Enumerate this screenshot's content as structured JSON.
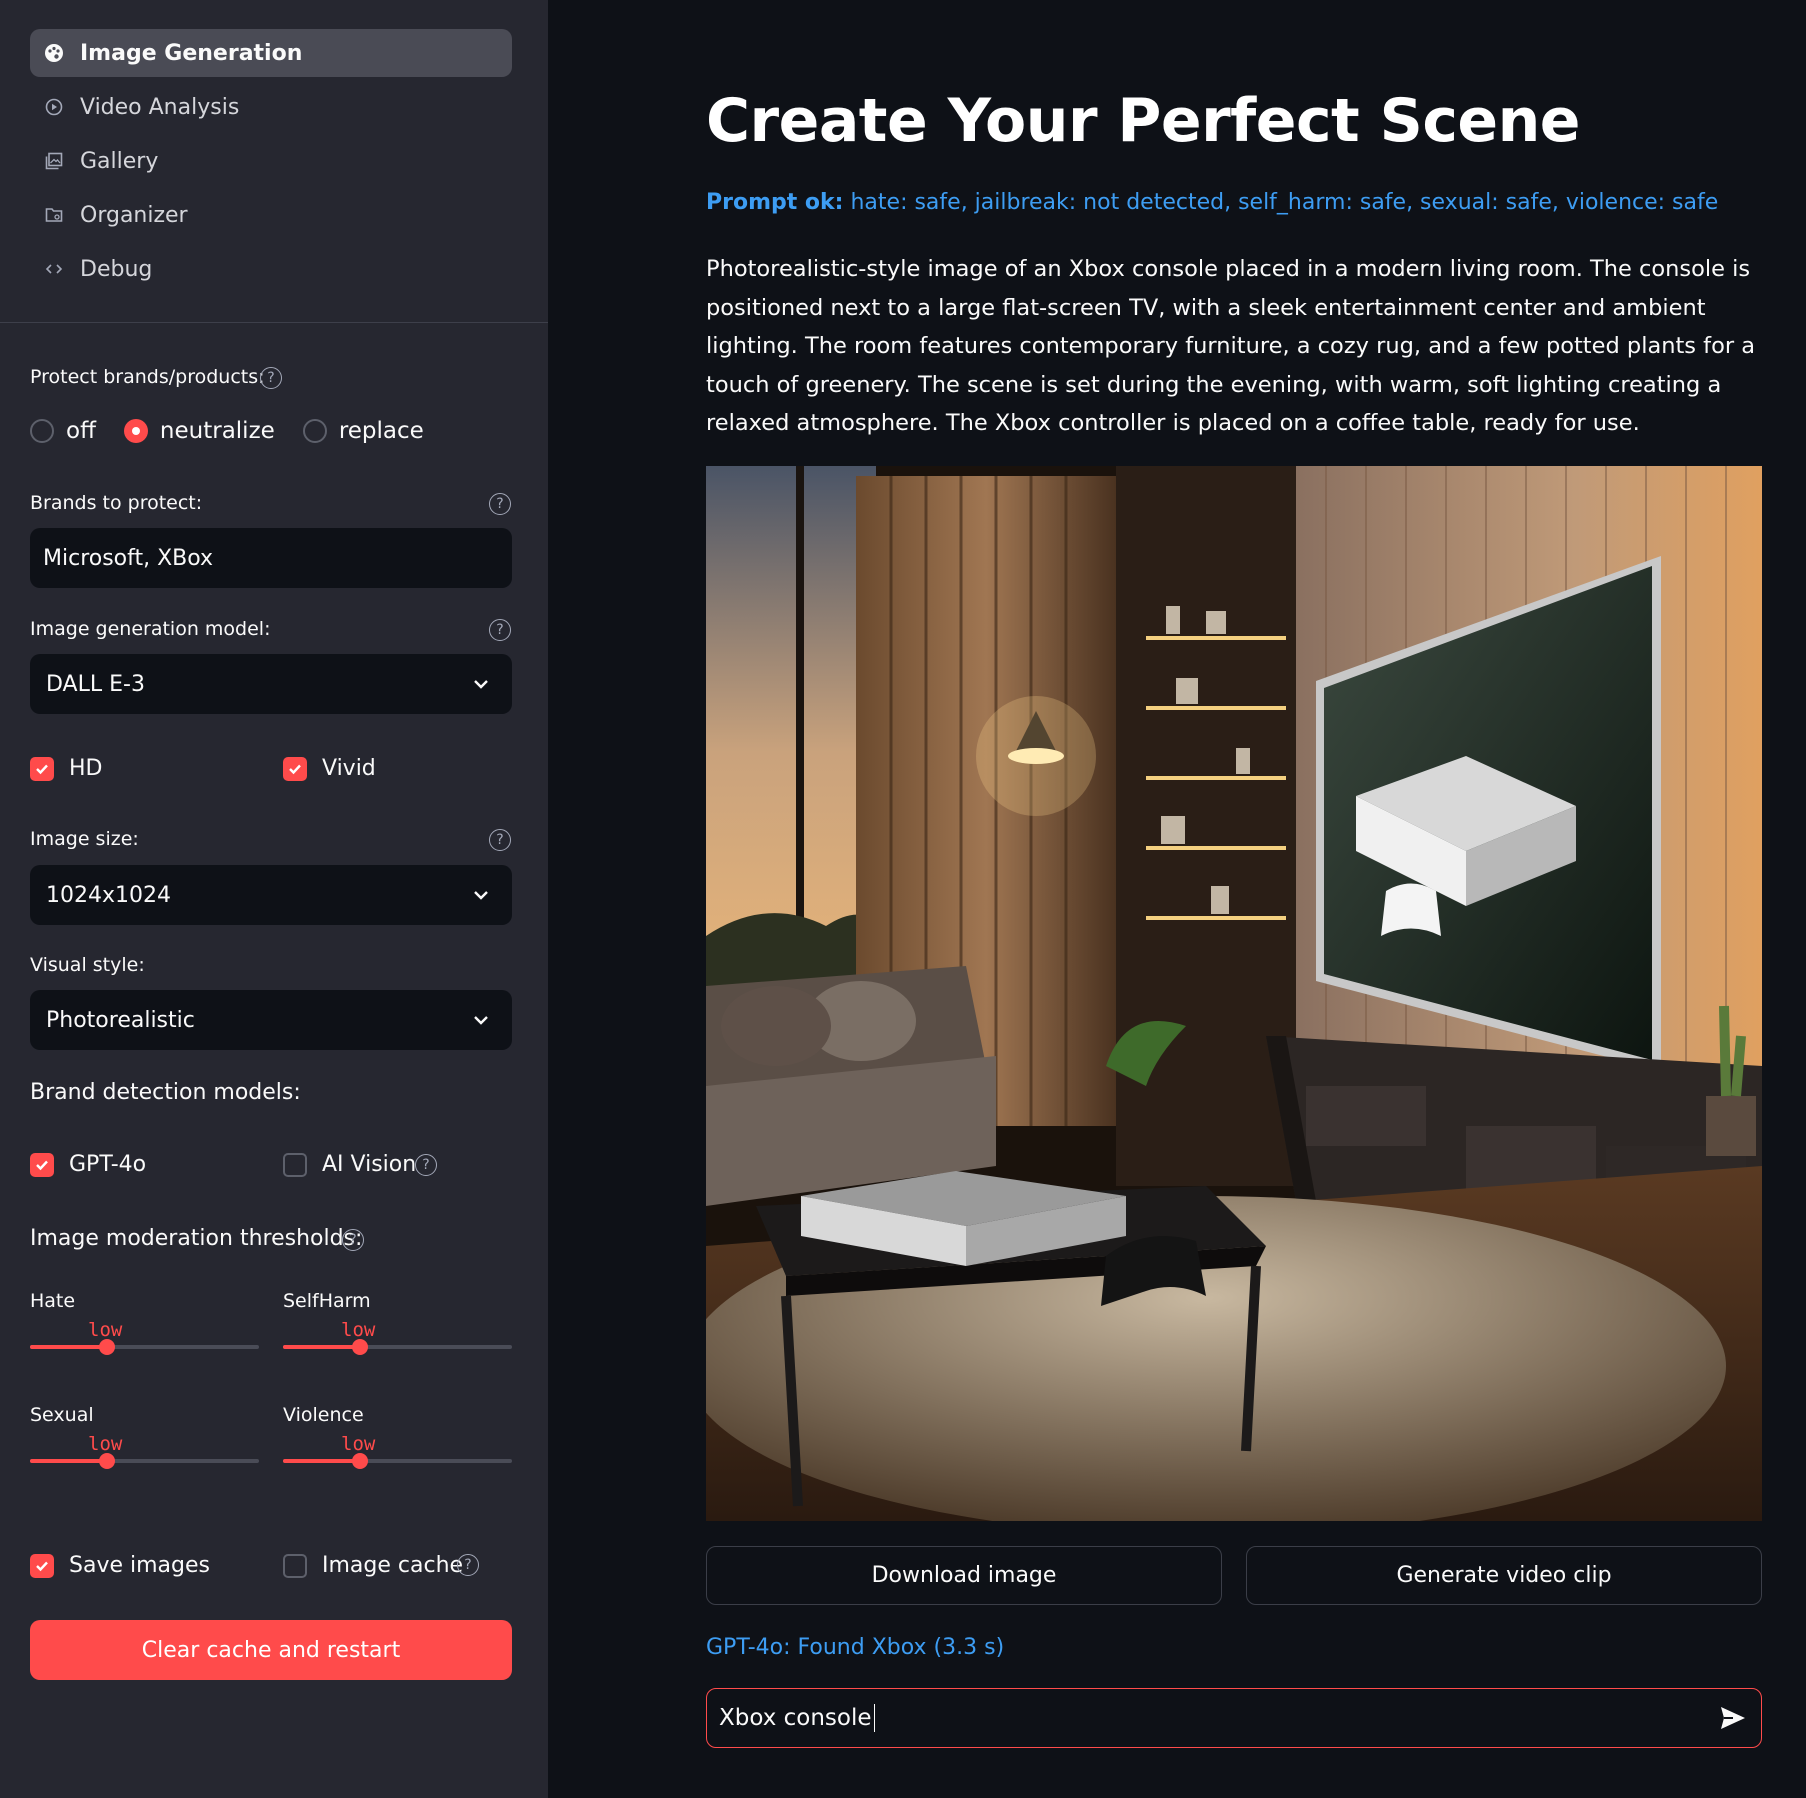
{
  "sidebar": {
    "nav": [
      {
        "label": "Image Generation",
        "icon": "palette-icon"
      },
      {
        "label": "Video Analysis",
        "icon": "play-circle-icon"
      },
      {
        "label": "Gallery",
        "icon": "gallery-icon"
      },
      {
        "label": "Organizer",
        "icon": "folder-icon"
      },
      {
        "label": "Debug",
        "icon": "code-icon"
      }
    ],
    "protect": {
      "label": "Protect brands/products:",
      "options": [
        "off",
        "neutralize",
        "replace"
      ],
      "selected": "neutralize"
    },
    "brands": {
      "label": "Brands to protect:",
      "value": "Microsoft, XBox"
    },
    "model": {
      "label": "Image generation model:",
      "value": "DALL E-3"
    },
    "hd": {
      "label": "HD",
      "checked": true
    },
    "vivid": {
      "label": "Vivid",
      "checked": true
    },
    "size": {
      "label": "Image size:",
      "value": "1024x1024"
    },
    "style": {
      "label": "Visual style:",
      "value": "Photorealistic"
    },
    "detection": {
      "label": "Brand detection models:",
      "gpt": {
        "label": "GPT-4o",
        "checked": true
      },
      "aivision": {
        "label": "AI Vision",
        "checked": false
      }
    },
    "moderation": {
      "label": "Image moderation thresholds:",
      "sliders": [
        {
          "name": "Hate",
          "value": "low"
        },
        {
          "name": "SelfHarm",
          "value": "low"
        },
        {
          "name": "Sexual",
          "value": "low"
        },
        {
          "name": "Violence",
          "value": "low"
        }
      ]
    },
    "save_images": {
      "label": "Save images",
      "checked": true
    },
    "image_cache": {
      "label": "Image cache",
      "checked": false
    },
    "clear_button": "Clear cache and restart"
  },
  "main": {
    "title": "Create Your Perfect Scene",
    "status_prefix": "Prompt ok:",
    "status_text": " hate: safe, jailbreak: not detected, self_harm: safe, sexual: safe, violence: safe",
    "description": "Photorealistic-style image of an Xbox console placed in a modern living room. The console is positioned next to a large flat-screen TV, with a sleek entertainment center and ambient lighting. The room features contemporary furniture, a cozy rug, and a few potted plants for a touch of greenery. The scene is set during the evening, with warm, soft lighting creating a relaxed atmosphere. The Xbox controller is placed on a coffee table, ready for use.",
    "download_button": "Download image",
    "video_button": "Generate video clip",
    "found_text": "GPT-4o: Found Xbox (3.3 s)",
    "chat_value": "Xbox console"
  },
  "colors": {
    "accent": "#ff4b4b",
    "info": "#3d9df3",
    "sidebar_bg": "#262730",
    "main_bg": "#0e1117"
  }
}
